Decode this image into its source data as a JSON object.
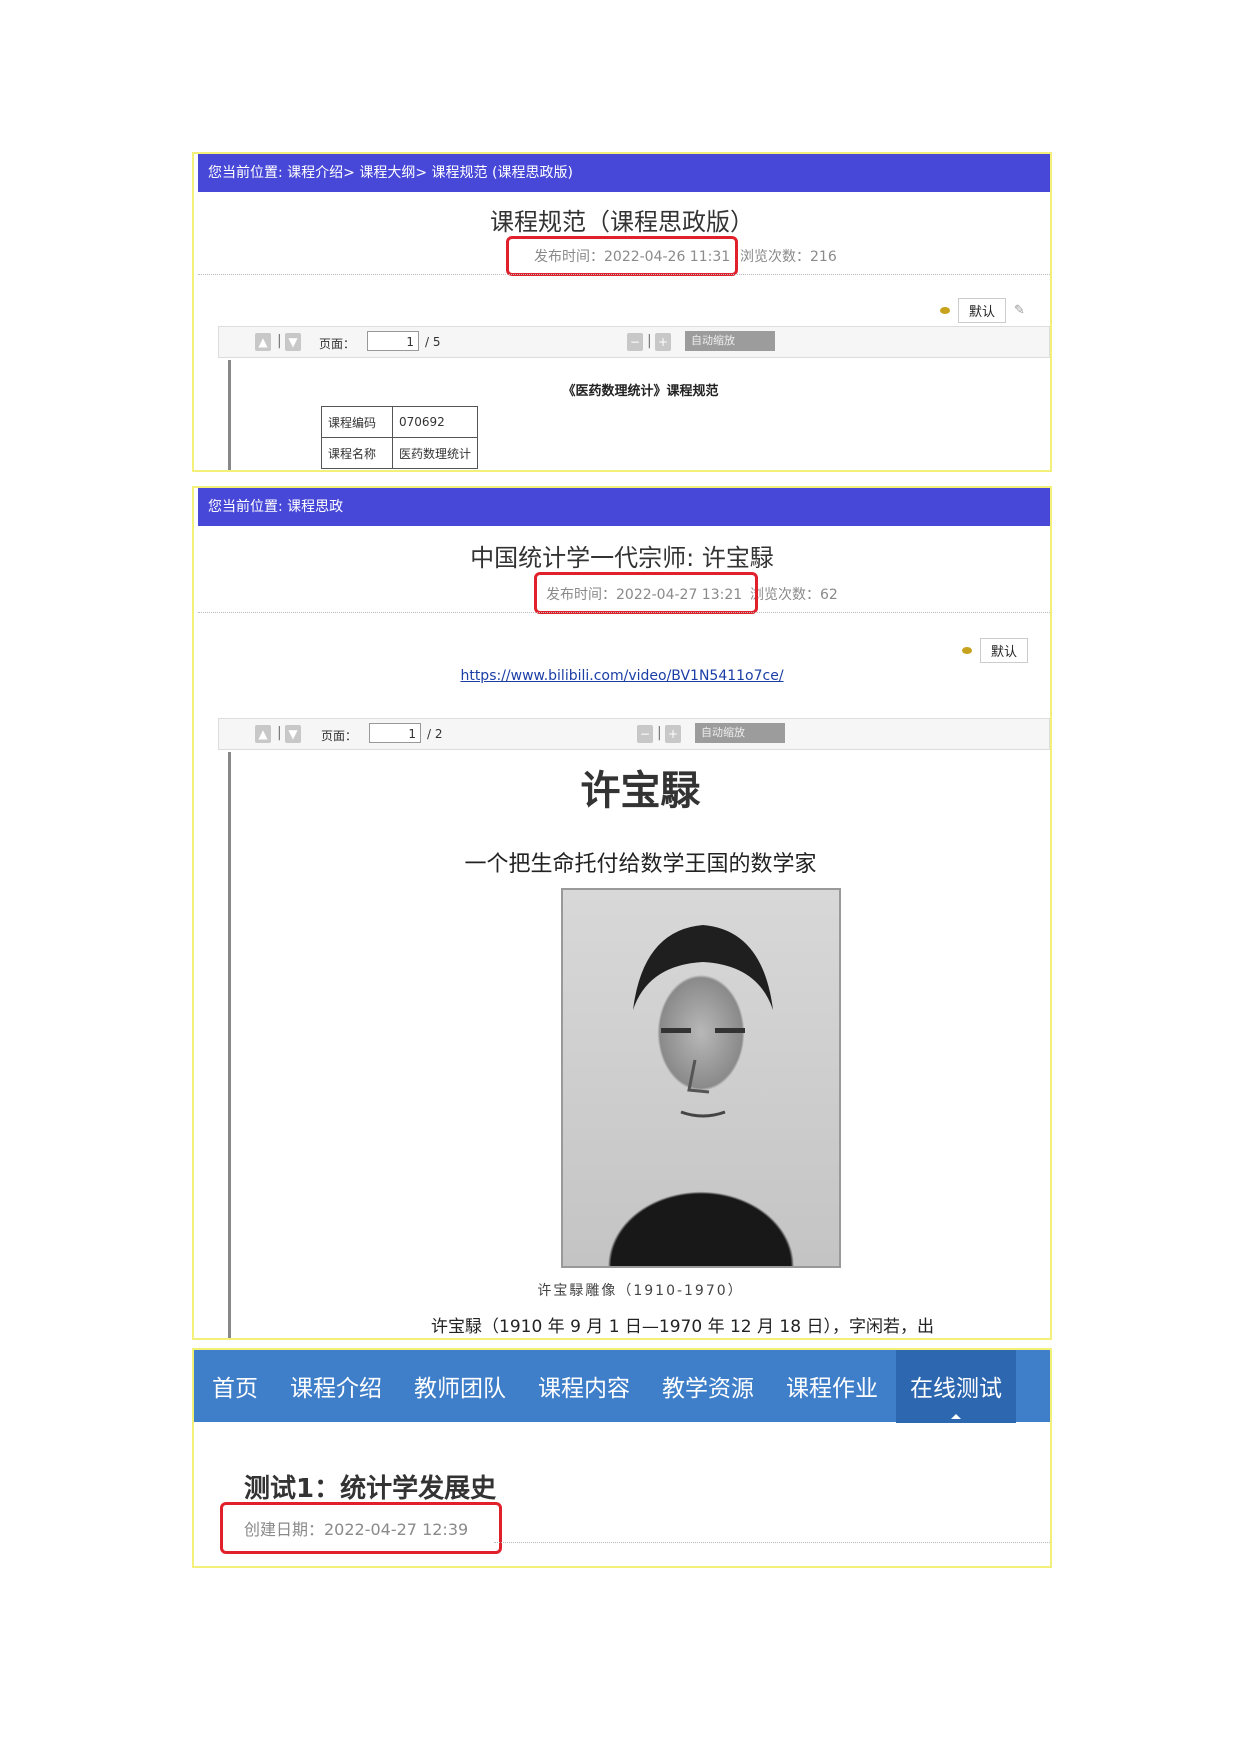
{
  "panel1": {
    "breadcrumb": "您当前位置:  课程介绍> 课程大纲> 课程规范 (课程思政版)",
    "title": "课程规范（课程思政版）",
    "publish": "发布时间：2022-04-26 11:31",
    "views": "浏览次数：216",
    "style_default": "默认",
    "pdf": {
      "page_label": "页面：",
      "page_current": "1",
      "page_total": "/ 5",
      "zoom_label": "自动缩放"
    },
    "doc_title": "《医药数理统计》课程规范",
    "table": [
      {
        "key": "课程编码",
        "value": "070692"
      },
      {
        "key": "课程名称",
        "value": "医药数理统计"
      }
    ]
  },
  "panel2": {
    "breadcrumb": "您当前位置:  课程思政",
    "title": "中国统计学一代宗师: 许宝騄",
    "publish": "发布时间：2022-04-27 13:21",
    "views": "浏览次数：62",
    "style_default": "默认",
    "link": "https://www.bilibili.com/video/BV1N5411o7ce/",
    "pdf": {
      "page_label": "页面：",
      "page_current": "1",
      "page_total": "/ 2",
      "zoom_label": "自动缩放"
    },
    "doc_heading": "许宝騄",
    "doc_subtitle": "一个把生命托付给数学王国的数学家",
    "photo_caption": "许宝騄雕像（1910-1970）",
    "doc_body": "许宝騄（1910 年 9 月 1 日—1970 年 12 月 18 日），字闲若，出"
  },
  "panel3": {
    "nav": [
      "首页",
      "课程介绍",
      "教师团队",
      "课程内容",
      "教学资源",
      "课程作业",
      "在线测试"
    ],
    "active_nav": "在线测试",
    "test_title": "测试1：统计学发展史",
    "created": "创建日期：2022-04-27 12:39"
  },
  "colors": {
    "breadcrumb_bg": "#4848d8",
    "nav_bg": "#3f7fc9",
    "highlight": "#e0202a",
    "frame": "#f3f07a"
  },
  "icons": [
    "page-up-icon",
    "page-down-icon",
    "zoom-out-icon",
    "zoom-in-icon",
    "style-dot-icon",
    "edit-pen-icon"
  ]
}
